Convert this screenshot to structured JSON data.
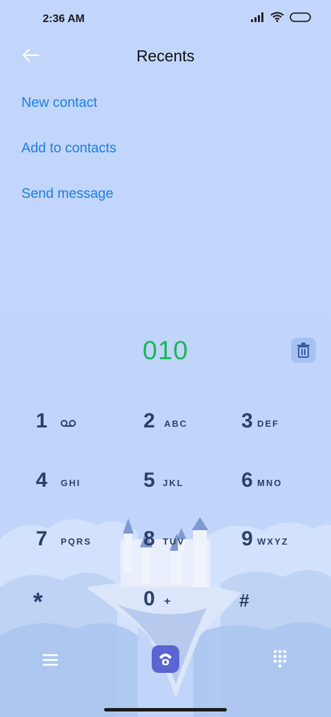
{
  "status_bar": {
    "time": "2:36 AM"
  },
  "header": {
    "title": "Recents"
  },
  "menu": {
    "new_contact": "New contact",
    "add_to_contacts": "Add to contacts",
    "send_message": "Send message"
  },
  "dialer": {
    "number": "010",
    "keys": [
      {
        "digit": "1",
        "letters": ""
      },
      {
        "digit": "2",
        "letters": "ABC"
      },
      {
        "digit": "3",
        "letters": "DEF"
      },
      {
        "digit": "4",
        "letters": "GHI"
      },
      {
        "digit": "5",
        "letters": "JKL"
      },
      {
        "digit": "6",
        "letters": "MNO"
      },
      {
        "digit": "7",
        "letters": "PQRS"
      },
      {
        "digit": "8",
        "letters": "TUV"
      },
      {
        "digit": "9",
        "letters": "WXYZ"
      },
      {
        "digit": "*",
        "letters": ""
      },
      {
        "digit": "0",
        "letters": "+"
      },
      {
        "digit": "#",
        "letters": ""
      }
    ]
  },
  "colors": {
    "accent": "#1b7fe0",
    "number": "#1cb55b",
    "call": "#5a64d2"
  }
}
